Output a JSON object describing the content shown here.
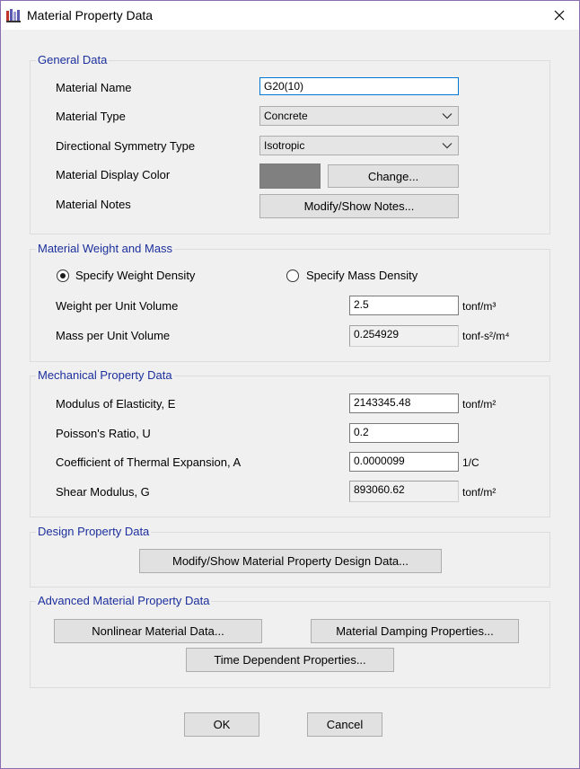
{
  "window": {
    "title": "Material Property Data"
  },
  "general": {
    "legend": "General Data",
    "material_name_label": "Material Name",
    "material_name_value": "G20(10)",
    "material_type_label": "Material Type",
    "material_type_value": "Concrete",
    "symmetry_label": "Directional Symmetry Type",
    "symmetry_value": "Isotropic",
    "display_color_label": "Material Display Color",
    "display_color": "#808080",
    "change_button": "Change...",
    "notes_label": "Material Notes",
    "notes_button": "Modify/Show Notes..."
  },
  "weight_mass": {
    "legend": "Material Weight and Mass",
    "radio_weight": "Specify Weight Density",
    "radio_mass": "Specify Mass Density",
    "selected": "weight",
    "weight_label": "Weight per Unit Volume",
    "weight_value": "2.5",
    "weight_unit": "tonf/m³",
    "mass_label": "Mass per Unit Volume",
    "mass_value": "0.254929",
    "mass_unit": "tonf-s²/m⁴"
  },
  "mechanical": {
    "legend": "Mechanical Property Data",
    "modulus_label": "Modulus of Elasticity,  E",
    "modulus_value": "2143345.48",
    "modulus_unit": "tonf/m²",
    "poisson_label": "Poisson's Ratio,  U",
    "poisson_value": "0.2",
    "thermal_label": "Coefficient of Thermal Expansion,  A",
    "thermal_value": "0.0000099",
    "thermal_unit": "1/C",
    "shear_label": "Shear Modulus,  G",
    "shear_value": "893060.62",
    "shear_unit": "tonf/m²"
  },
  "design": {
    "legend": "Design Property Data",
    "button": "Modify/Show Material Property Design Data..."
  },
  "advanced": {
    "legend": "Advanced Material Property Data",
    "nonlinear_button": "Nonlinear Material Data...",
    "damping_button": "Material Damping Properties...",
    "time_button": "Time Dependent Properties..."
  },
  "footer": {
    "ok": "OK",
    "cancel": "Cancel"
  }
}
